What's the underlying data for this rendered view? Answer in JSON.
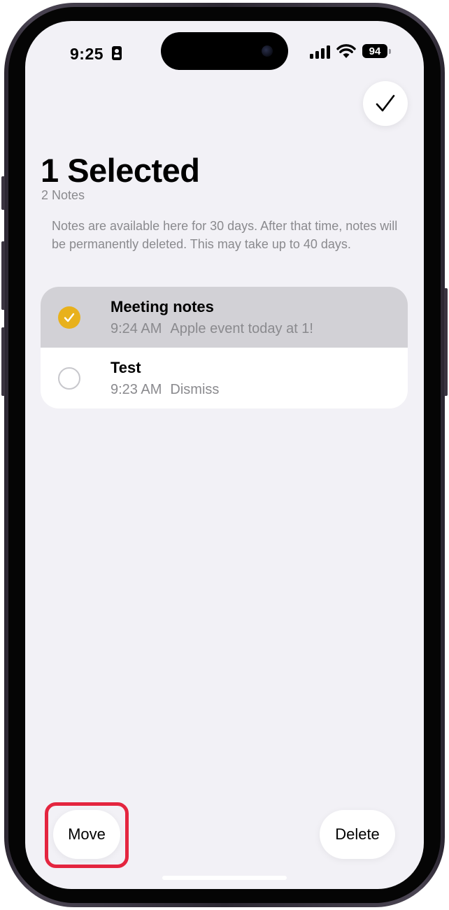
{
  "status_bar": {
    "time": "9:25",
    "battery": "94"
  },
  "header": {
    "title": "1 Selected",
    "subtitle": "2 Notes",
    "info": "Notes are available here for 30 days. After that time, notes will be permanently deleted. This may take up to 40 days."
  },
  "notes": [
    {
      "title": "Meeting notes",
      "time": "9:24 AM",
      "preview": "Apple event today at 1!",
      "selected": true
    },
    {
      "title": "Test",
      "time": "9:23 AM",
      "preview": "Dismiss",
      "selected": false
    }
  ],
  "toolbar": {
    "move_label": "Move",
    "delete_label": "Delete"
  },
  "colors": {
    "accent": "#e8b11c",
    "highlight": "#e4253f",
    "background": "#f2f1f6"
  }
}
